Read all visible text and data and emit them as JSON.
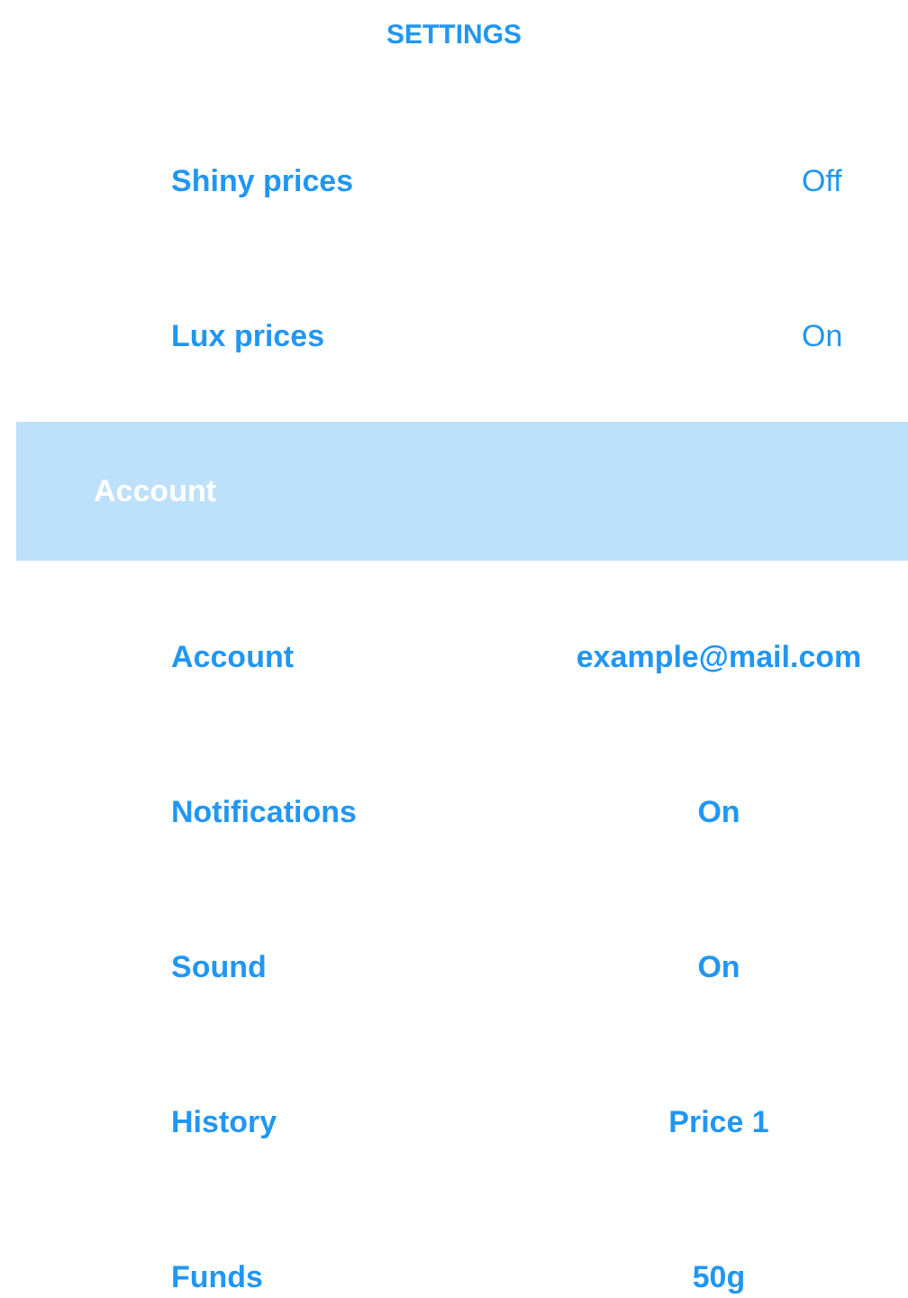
{
  "title": "SETTINGS",
  "sections": [
    {
      "rows": [
        {
          "kind": "toggle",
          "label": "Shiny prices",
          "value": "Off"
        },
        {
          "kind": "toggle",
          "label": "Lux prices",
          "value": "On"
        }
      ]
    },
    {
      "header": "Account",
      "rows": [
        {
          "kind": "info",
          "label": "Account",
          "value": "example@mail.com"
        },
        {
          "kind": "info",
          "label": "Notifications",
          "value": "On"
        },
        {
          "kind": "info",
          "label": "Sound",
          "value": "On"
        },
        {
          "kind": "info",
          "label": "History",
          "value": "Price 1"
        },
        {
          "kind": "info",
          "label": "Funds",
          "value": "50g"
        }
      ]
    }
  ]
}
